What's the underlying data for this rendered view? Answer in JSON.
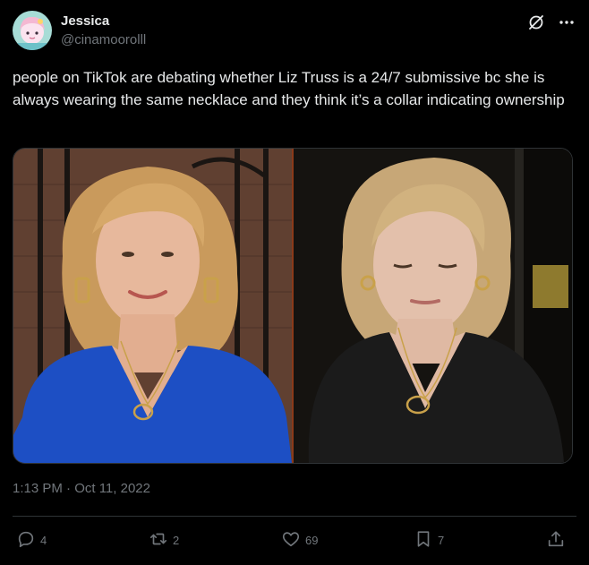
{
  "author": {
    "display_name": "Jessica",
    "handle": "@cinamoorolll",
    "avatar_icon": "avatar-illustration"
  },
  "header_icons": [
    "grok-icon",
    "more-icon"
  ],
  "tweet": {
    "text": "people on TikTok are debating whether Liz Truss is a 24/7 submissive bc she is always wearing the same necklace and  they think it’s a collar indicating ownership",
    "timestamp": "1:13 PM · Oct 11, 2022"
  },
  "media": {
    "left_panel": {
      "outfit_color": "#1d4fc4",
      "background": "brick-and-iron-gate"
    },
    "right_panel": {
      "outfit_color": "#151515",
      "background": "dark-doorway"
    }
  },
  "actions": {
    "replies": {
      "icon": "reply-icon",
      "count": "4"
    },
    "retweets": {
      "icon": "retweet-icon",
      "count": "2"
    },
    "likes": {
      "icon": "like-icon",
      "count": "69"
    },
    "bookmarks": {
      "icon": "bookmark-icon",
      "count": "7"
    },
    "share": {
      "icon": "share-icon"
    }
  },
  "colors": {
    "background": "#000000",
    "text_primary": "#e7e9ea",
    "text_secondary": "#71767b",
    "border": "#2f3336"
  }
}
